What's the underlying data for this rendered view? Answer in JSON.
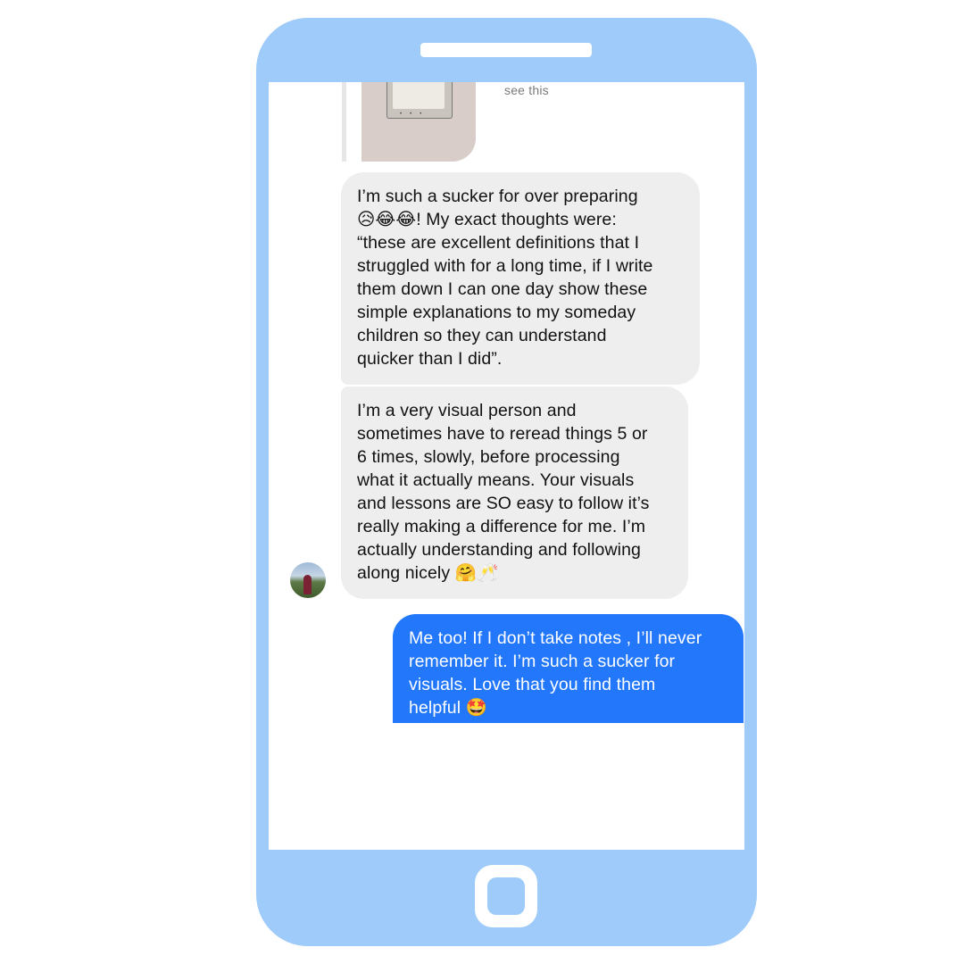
{
  "conversation": {
    "reply_preview": {
      "text": "see this"
    },
    "incoming": [
      {
        "lines": [
          "I’m such a sucker for over preparing",
          "😥😂😂! My exact thoughts were:",
          "“these are excellent definitions that I",
          "struggled with for a long time, if I write",
          "them down I can one day show these",
          "simple explanations to my someday",
          "children so they can understand",
          "quicker than I did”."
        ]
      },
      {
        "lines": [
          "I’m a very visual person and",
          "sometimes have to reread things 5 or",
          "6 times, slowly, before processing",
          "what it actually means. Your visuals",
          "and lessons are SO easy to follow it’s",
          "really making a difference for me. I’m",
          "actually understanding and following",
          "along nicely 🤗🥂"
        ]
      }
    ],
    "outgoing": [
      {
        "lines": [
          "Me too! If I don’t take notes , I’ll never",
          "remember it. I’m such a sucker for",
          "visuals. Love that you find them",
          "helpful 🤩"
        ]
      }
    ]
  },
  "colors": {
    "phone_frame": "#9ecbfa",
    "incoming_bubble": "#eeeeee",
    "outgoing_bubble": "#2277fb"
  }
}
